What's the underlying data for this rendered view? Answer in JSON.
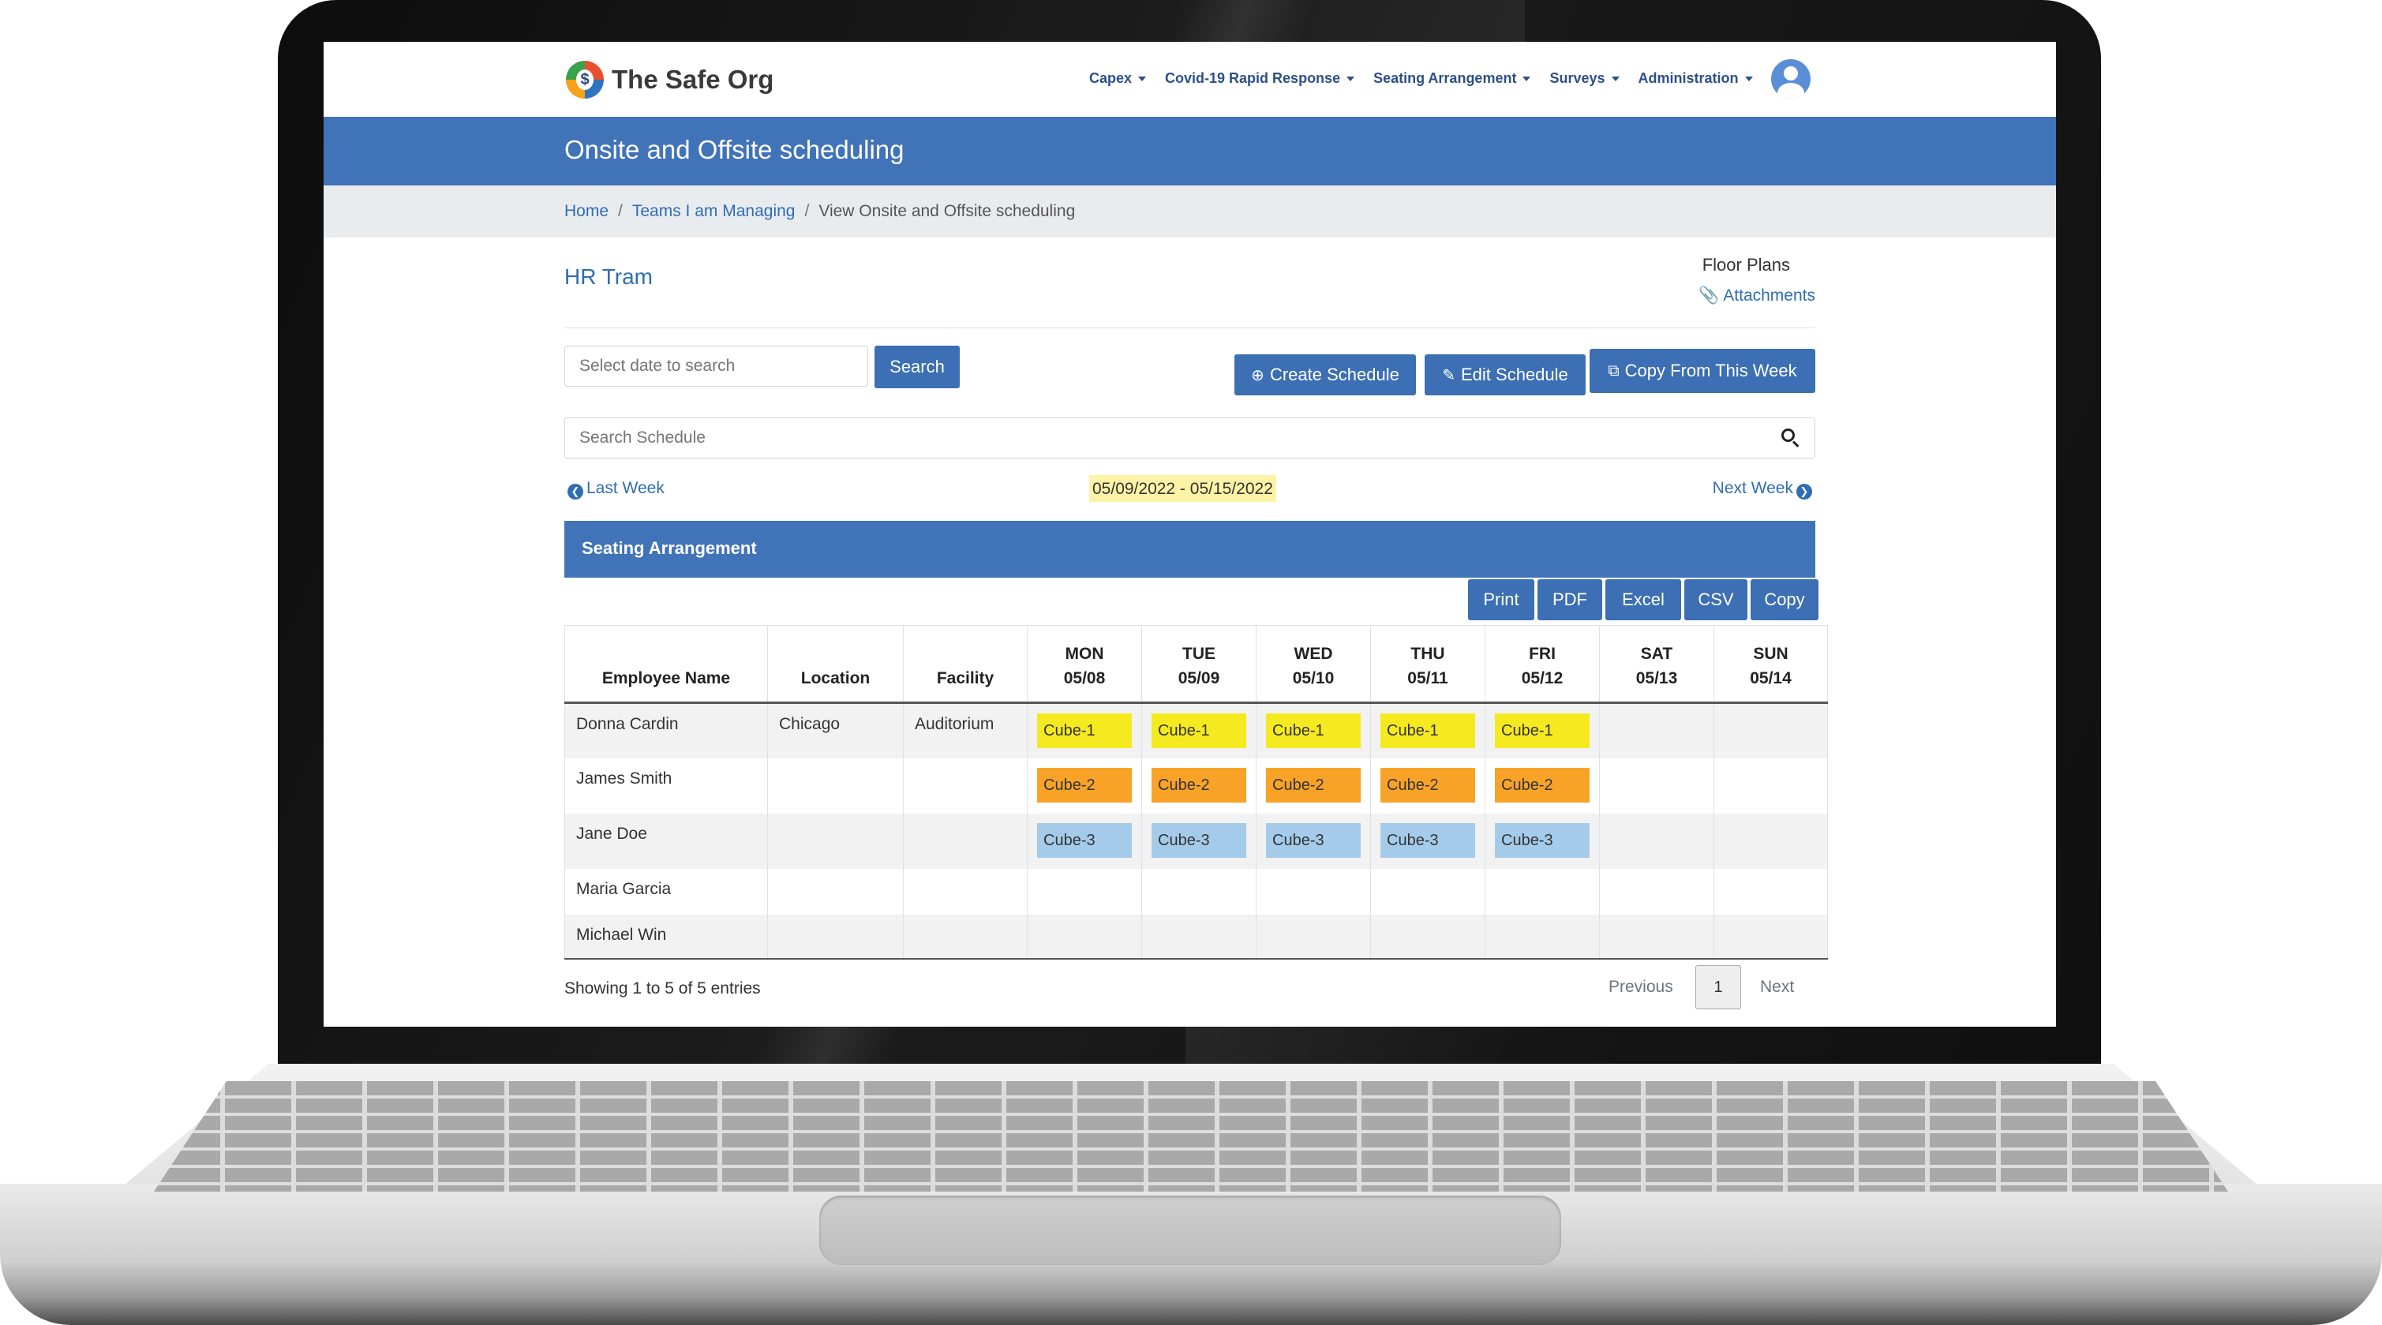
{
  "brand": {
    "name": "The Safe Org",
    "logo_letter": "$"
  },
  "nav": {
    "items": [
      {
        "label": "Capex"
      },
      {
        "label": "Covid-19 Rapid Response"
      },
      {
        "label": "Seating Arrangement"
      },
      {
        "label": "Surveys"
      },
      {
        "label": "Administration"
      }
    ]
  },
  "page": {
    "title": "Onsite and Offsite scheduling"
  },
  "breadcrumb": {
    "home": "Home",
    "sep": "/",
    "teams": "Teams I am Managing",
    "current": "View Onsite and Offsite scheduling"
  },
  "team": {
    "name": "HR Tram"
  },
  "floor_plans": {
    "label": "Floor Plans",
    "attachments": "Attachments"
  },
  "date_search": {
    "placeholder": "Select date to search",
    "button": "Search"
  },
  "actions": {
    "create": "Create Schedule",
    "edit": "Edit Schedule",
    "copy_week": "Copy From This Week"
  },
  "schedule_search": {
    "placeholder": "Search Schedule"
  },
  "week_nav": {
    "last": "Last Week",
    "range": "05/09/2022 - 05/15/2022",
    "next": "Next Week"
  },
  "panel": {
    "title": "Seating Arrangement"
  },
  "export": {
    "print": "Print",
    "pdf": "PDF",
    "excel": "Excel",
    "csv": "CSV",
    "copy": "Copy"
  },
  "table": {
    "headers": {
      "employee": "Employee Name",
      "location": "Location",
      "facility": "Facility",
      "days": [
        {
          "day": "MON",
          "date": "05/08"
        },
        {
          "day": "TUE",
          "date": "05/09"
        },
        {
          "day": "WED",
          "date": "05/10"
        },
        {
          "day": "THU",
          "date": "05/11"
        },
        {
          "day": "FRI",
          "date": "05/12"
        },
        {
          "day": "SAT",
          "date": "05/13"
        },
        {
          "day": "SUN",
          "date": "05/14"
        }
      ]
    },
    "rows": [
      {
        "name": "Donna Cardin",
        "location": "Chicago",
        "facility": "Auditorium",
        "cube": "Cube-1",
        "color": "#f5ea1f"
      },
      {
        "name": "James Smith",
        "location": "",
        "facility": "",
        "cube": "Cube-2",
        "color": "#f8a327"
      },
      {
        "name": "Jane Doe",
        "location": "",
        "facility": "",
        "cube": "Cube-3",
        "color": "#a4cbea"
      },
      {
        "name": "Maria Garcia",
        "location": "",
        "facility": "",
        "cube": "",
        "color": ""
      },
      {
        "name": "Michael Win",
        "location": "",
        "facility": "",
        "cube": "",
        "color": ""
      }
    ]
  },
  "footer": {
    "showing": "Showing 1 to 5 of 5 entries",
    "previous": "Previous",
    "page": "1",
    "next": "Next"
  },
  "colors": {
    "primary": "#4173b9",
    "button": "#3c6fb3",
    "link": "#2f6db5",
    "highlight": "#fdf3a6"
  }
}
